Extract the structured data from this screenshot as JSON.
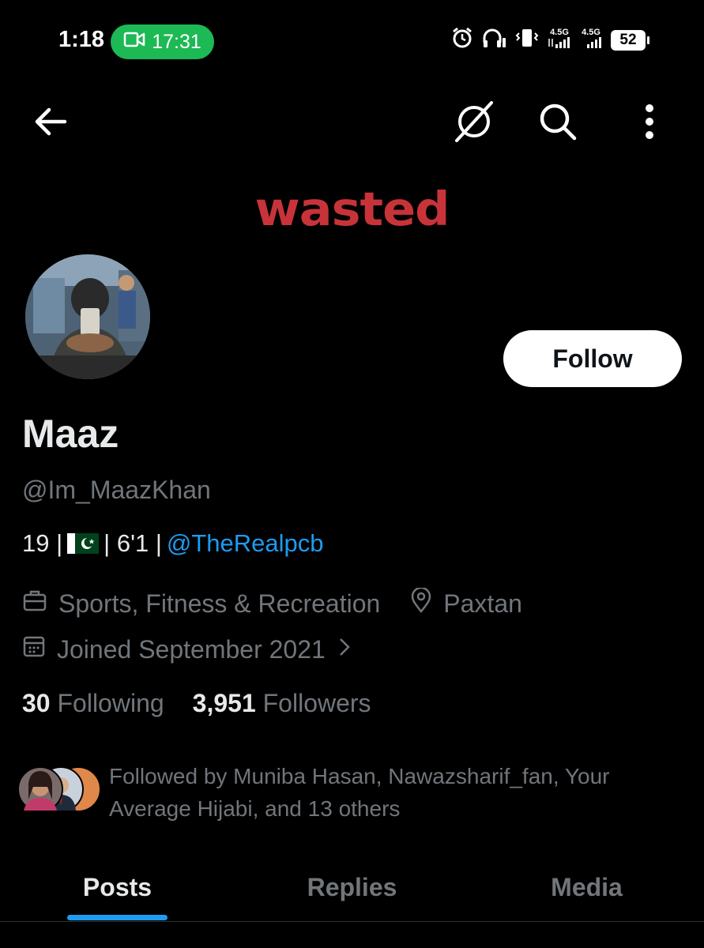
{
  "status_bar": {
    "time": "1:18",
    "call_duration": "17:31",
    "network_1": "4.5G",
    "network_2": "4.5G",
    "battery": "52"
  },
  "banner": {
    "text": "wasted",
    "color": "#c8333a"
  },
  "profile": {
    "name": "Maaz",
    "handle": "@Im_MaazKhan",
    "bio_prefix": "19 |",
    "bio_middle": "| 6'1 |",
    "bio_link": "@TheRealpcb",
    "category": "Sports, Fitness & Recreation",
    "location": "Paxtan",
    "joined": "Joined September 2021",
    "following_count": "30",
    "following_label": "Following",
    "followers_count": "3,951",
    "followers_label": "Followers",
    "followed_by": "Followed by Muniba Hasan, Nawazsharif_fan, Your Average Hijabi, and 13 others"
  },
  "follow_button": {
    "label": "Follow"
  },
  "tabs": [
    {
      "label": "Posts",
      "active": true
    },
    {
      "label": "Replies",
      "active": false
    },
    {
      "label": "Media",
      "active": false
    }
  ],
  "colors": {
    "accent": "#1d9bf0",
    "background": "#000000",
    "muted": "#71767b"
  },
  "icons": [
    "back-arrow-icon",
    "grok-icon",
    "search-icon",
    "more-vertical-icon",
    "briefcase-icon",
    "location-pin-icon",
    "calendar-icon",
    "chevron-right-icon"
  ]
}
